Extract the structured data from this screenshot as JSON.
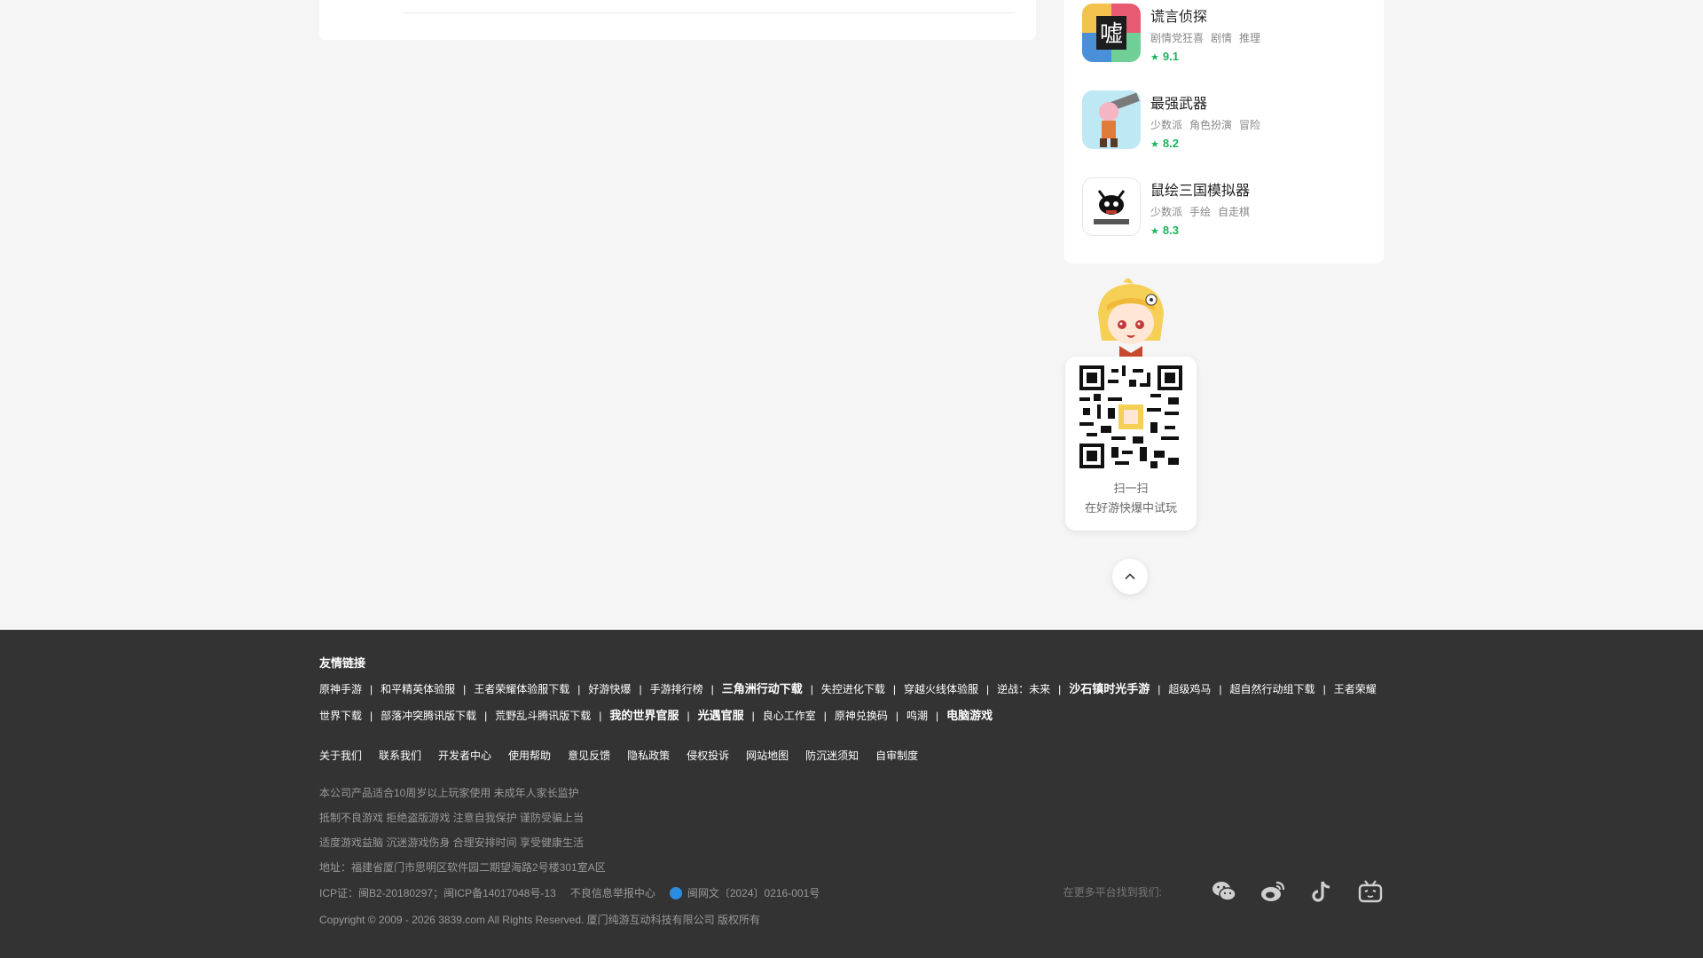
{
  "games": [
    {
      "name": "谎言侦探",
      "tags": [
        "剧情党狂喜",
        "剧情",
        "推理"
      ],
      "score": "9.1",
      "thumb_color": "#7a3f8f"
    },
    {
      "name": "最强武器",
      "tags": [
        "少数派",
        "角色扮演",
        "冒险"
      ],
      "score": "8.2",
      "thumb_color": "#8fd1e8"
    },
    {
      "name": "鼠绘三国模拟器",
      "tags": [
        "少数派",
        "手绘",
        "自走棋"
      ],
      "score": "8.3",
      "thumb_color": "#ffffff"
    }
  ],
  "qr": {
    "line1": "扫一扫",
    "line2": "在好游快爆中试玩"
  },
  "footer": {
    "friend_title": "友情链接",
    "friend_links": [
      {
        "text": "原神手游",
        "bold": false
      },
      {
        "text": "和平精英体验服",
        "bold": false
      },
      {
        "text": "王者荣耀体验服下载",
        "bold": false
      },
      {
        "text": "好游快爆",
        "bold": false
      },
      {
        "text": "手游排行榜",
        "bold": false
      },
      {
        "text": "三角洲行动下载",
        "bold": true
      },
      {
        "text": "失控进化下载",
        "bold": false
      },
      {
        "text": "穿越火线体验服",
        "bold": false
      },
      {
        "text": "逆战：未来",
        "bold": false
      },
      {
        "text": "沙石镇时光手游",
        "bold": true
      },
      {
        "text": "超级鸡马",
        "bold": false
      },
      {
        "text": "超自然行动组下载",
        "bold": false
      },
      {
        "text": "王者荣耀世界下载",
        "bold": false
      },
      {
        "text": "部落冲突腾讯版下载",
        "bold": false
      },
      {
        "text": "荒野乱斗腾讯版下载",
        "bold": false
      },
      {
        "text": "我的世界官服",
        "bold": true
      },
      {
        "text": "光遇官服",
        "bold": true
      },
      {
        "text": "良心工作室",
        "bold": false
      },
      {
        "text": "原神兑换码",
        "bold": false
      },
      {
        "text": "鸣潮",
        "bold": false
      },
      {
        "text": "电脑游戏",
        "bold": true
      }
    ],
    "about_links": [
      "关于我们",
      "联系我们",
      "开发者中心",
      "使用帮助",
      "意见反馈",
      "隐私政策",
      "侵权投诉",
      "网站地图",
      "防沉迷须知",
      "自审制度"
    ],
    "notes": [
      "本公司产品适合10周岁以上玩家使用    未成年人家长监护",
      "抵制不良游戏 拒绝盗版游戏 注意自我保护 谨防受骗上当",
      "适度游戏益脑 沉迷游戏伤身 合理安排时间 享受健康生活",
      "地址：福建省厦门市思明区软件园二期望海路2号楼301室A区"
    ],
    "icp": "ICP证：闽B2-20180297；闽ICP备14017048号-13",
    "report": "不良信息举报中心",
    "culture": "闽网文〔2024〕0216-001号",
    "copyright": "Copyright © 2009 - 2026 3839.com All Rights Reserved. 厦门纯游互动科技有限公司 版权所有",
    "social_label": "在更多平台找到我们:",
    "social_icons": [
      "wechat-icon",
      "weibo-icon",
      "douyin-icon",
      "bilibili-icon"
    ]
  }
}
